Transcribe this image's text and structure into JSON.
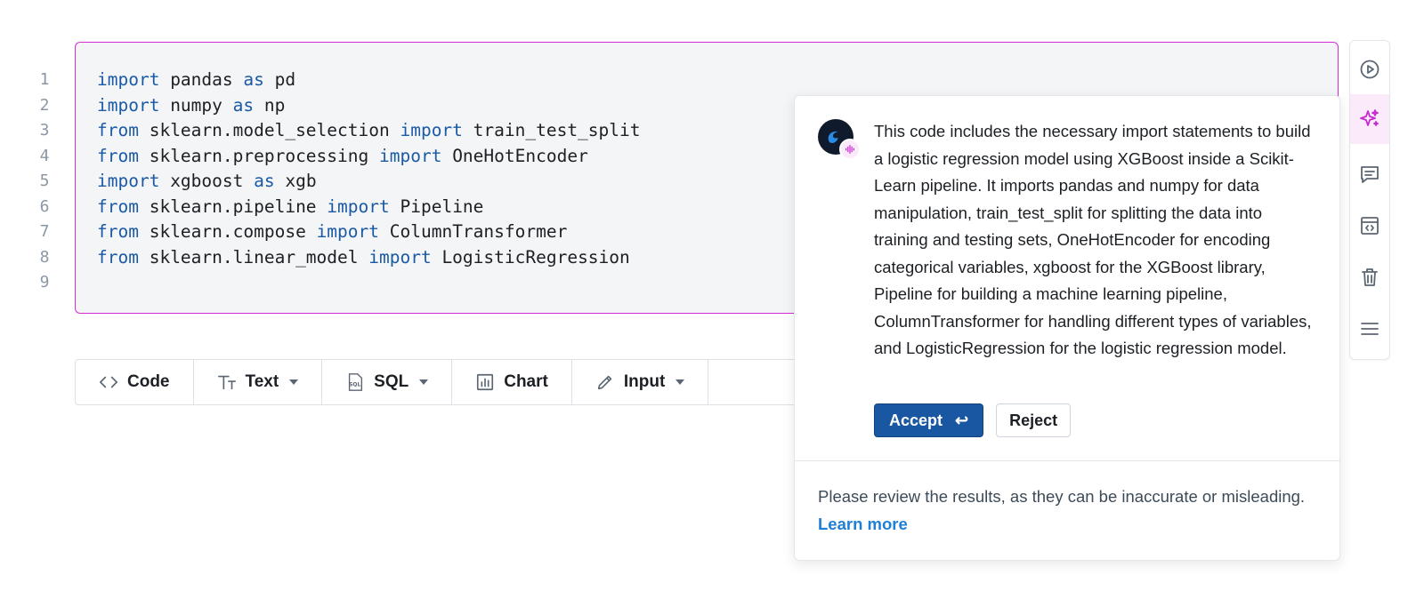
{
  "code_cell": {
    "line_numbers": [
      "1",
      "2",
      "3",
      "4",
      "5",
      "6",
      "7",
      "8",
      "9"
    ],
    "lines": [
      [
        {
          "t": "import",
          "k": true
        },
        {
          "t": " pandas ",
          "k": false
        },
        {
          "t": "as",
          "k": true
        },
        {
          "t": " pd",
          "k": false
        }
      ],
      [
        {
          "t": "import",
          "k": true
        },
        {
          "t": " numpy ",
          "k": false
        },
        {
          "t": "as",
          "k": true
        },
        {
          "t": " np",
          "k": false
        }
      ],
      [
        {
          "t": "from",
          "k": true
        },
        {
          "t": " sklearn.model_selection ",
          "k": false
        },
        {
          "t": "import",
          "k": true
        },
        {
          "t": " train_test_split",
          "k": false
        }
      ],
      [
        {
          "t": "from",
          "k": true
        },
        {
          "t": " sklearn.preprocessing ",
          "k": false
        },
        {
          "t": "import",
          "k": true
        },
        {
          "t": " OneHotEncoder",
          "k": false
        }
      ],
      [
        {
          "t": "import",
          "k": true
        },
        {
          "t": " xgboost ",
          "k": false
        },
        {
          "t": "as",
          "k": true
        },
        {
          "t": " xgb",
          "k": false
        }
      ],
      [
        {
          "t": "from",
          "k": true
        },
        {
          "t": " sklearn.pipeline ",
          "k": false
        },
        {
          "t": "import",
          "k": true
        },
        {
          "t": " Pipeline",
          "k": false
        }
      ],
      [
        {
          "t": "from",
          "k": true
        },
        {
          "t": " sklearn.compose ",
          "k": false
        },
        {
          "t": "import",
          "k": true
        },
        {
          "t": " ColumnTransformer",
          "k": false
        }
      ],
      [
        {
          "t": "from",
          "k": true
        },
        {
          "t": " sklearn.linear_model ",
          "k": false
        },
        {
          "t": "import",
          "k": true
        },
        {
          "t": " LogisticRegression",
          "k": false
        }
      ],
      []
    ]
  },
  "add_bar": {
    "code_label": "Code",
    "text_label": "Text",
    "sql_label": "SQL",
    "chart_label": "Chart",
    "input_label": "Input"
  },
  "side_toolbar": {
    "icons": [
      "play-icon",
      "ai-sparkle-icon",
      "comment-icon",
      "code-embed-icon",
      "trash-icon",
      "menu-icon"
    ]
  },
  "ai_panel": {
    "explanation": "This code includes the necessary import statements to build a logistic regression model using XGBoost inside a Scikit-Learn pipeline. It imports pandas and numpy for data manipulation, train_test_split for splitting the data into training and testing sets, OneHotEncoder for encoding categorical variables, xgboost for the XGBoost library, Pipeline for building a machine learning pipeline, ColumnTransformer for handling different types of variables, and LogisticRegression for the logistic regression model.",
    "accept_label": "Accept",
    "accept_shortcut": "↩",
    "reject_label": "Reject",
    "disclaimer": "Please review the results, as they can be inaccurate or misleading.",
    "learn_more": "Learn more"
  },
  "colors": {
    "accent_magenta": "#d32dd6",
    "primary_blue": "#1957a3",
    "link_blue": "#1f7ed6",
    "keyword_blue": "#1a5aa5"
  }
}
